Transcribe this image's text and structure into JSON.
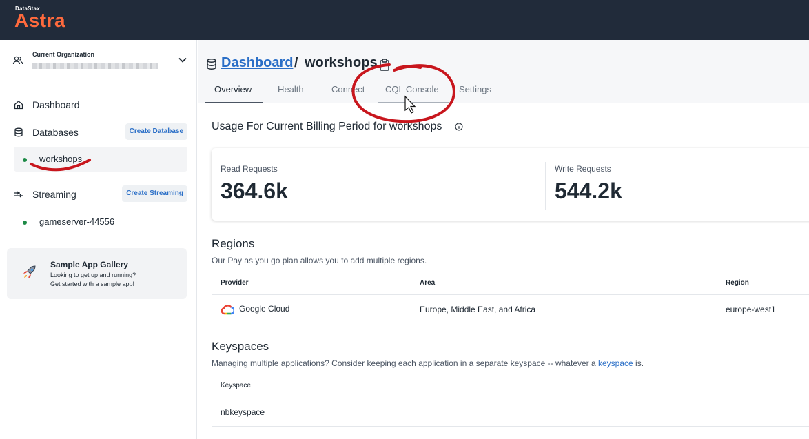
{
  "brand": {
    "small": "DataStax",
    "big": "Astra"
  },
  "org": {
    "label": "Current Organization"
  },
  "sidebar": {
    "items": [
      {
        "label": "Dashboard"
      },
      {
        "label": "Databases",
        "action": "Create Database"
      },
      {
        "label": "workshops"
      },
      {
        "label": "Streaming",
        "action": "Create Streaming"
      },
      {
        "label": "gameserver-44556"
      }
    ],
    "gallery": {
      "title": "Sample App Gallery",
      "line1": "Looking to get up and running?",
      "line2": "Get started with a sample app!"
    }
  },
  "breadcrumb": {
    "link": "Dashboard",
    "separator": "/",
    "current": "workshops"
  },
  "tabs": [
    {
      "label": "Overview"
    },
    {
      "label": "Health"
    },
    {
      "label": "Connect"
    },
    {
      "label": "CQL Console"
    },
    {
      "label": "Settings"
    }
  ],
  "usage": {
    "title": "Usage For Current Billing Period for workshops",
    "read_label": "Read Requests",
    "read_value": "364.6k",
    "write_label": "Write Requests",
    "write_value": "544.2k"
  },
  "regions": {
    "title": "Regions",
    "desc": "Our Pay as you go plan allows you to add multiple regions.",
    "headers": [
      "Provider",
      "Area",
      "Region"
    ],
    "rows": [
      {
        "provider": "Google Cloud",
        "area": "Europe, Middle East, and Africa",
        "region": "europe-west1"
      }
    ]
  },
  "keyspaces": {
    "title": "Keyspaces",
    "desc_prefix": "Managing multiple applications? Consider keeping each application in a separate keyspace -- whatever a ",
    "desc_link": "keyspace",
    "desc_suffix": " is.",
    "header": "Keyspace",
    "rows": [
      {
        "name": "nbkeyspace"
      }
    ]
  },
  "colors": {
    "topbar": "#212b3a",
    "brand": "#ff6a3d",
    "link": "#2b6fc7",
    "status_dot": "#1d8a46",
    "annotation": "#c8161d"
  }
}
